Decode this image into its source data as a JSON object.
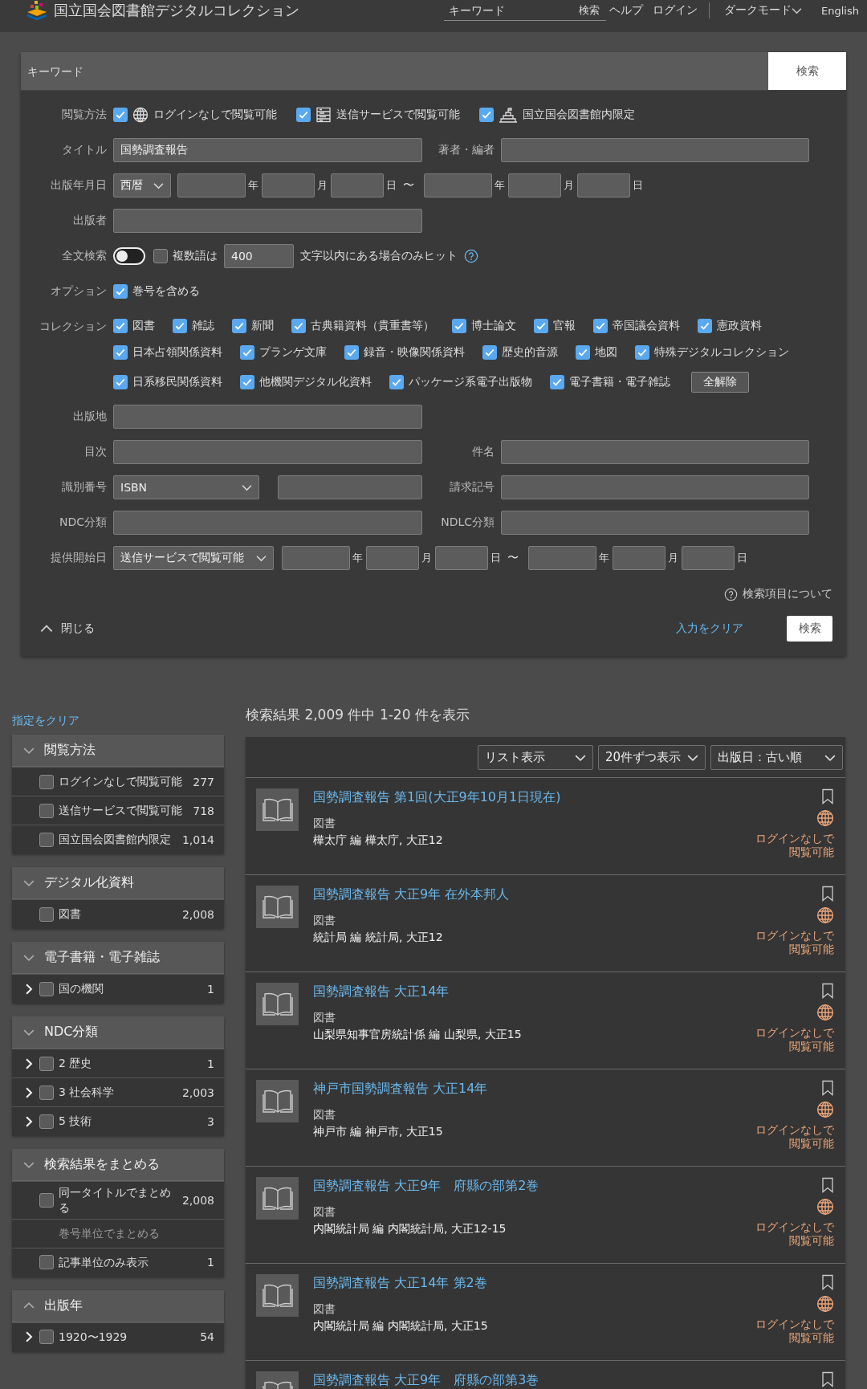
{
  "header": {
    "site_title": "国立国会図書館デジタルコレクション",
    "search_placeholder": "キーワード",
    "search_button": "検索",
    "links": [
      "ヘルプ",
      "ログイン"
    ],
    "dark_mode": "ダークモード",
    "language": "English"
  },
  "search_form": {
    "keyword_placeholder": "キーワード",
    "keyword_button": "検索",
    "access": {
      "label": "閲覧方法",
      "options": [
        {
          "label": "ログインなしで閲覧可能",
          "checked": true,
          "kind": "globe"
        },
        {
          "label": "送信サービスで閲覧可能",
          "checked": true,
          "kind": "transmission"
        },
        {
          "label": "国立国会図書館内限定",
          "checked": true,
          "kind": "building"
        }
      ]
    },
    "title": {
      "label": "タイトル",
      "value": "国勢調査報告"
    },
    "author": {
      "label": "著者・編者"
    },
    "publication_date": {
      "label": "出版年月日",
      "era": "西暦",
      "from_units": [
        "年",
        "月",
        "日"
      ],
      "separator": "〜",
      "to_units": [
        "年",
        "月",
        "日"
      ]
    },
    "publisher": {
      "label": "出版者"
    },
    "full_text": {
      "label": "全文検索",
      "toggle_on": false,
      "multi_word": {
        "label": "複数語は",
        "checked": false
      },
      "distance": "400",
      "suffix": "文字以内にある場合のみヒット"
    },
    "options": {
      "label": "オプション",
      "items": [
        {
          "label": "巻号を含める",
          "checked": true
        }
      ]
    },
    "collections": {
      "label": "コレクション",
      "clear_button": "全解除",
      "items": [
        {
          "label": "図書",
          "checked": true
        },
        {
          "label": "雑誌",
          "checked": true
        },
        {
          "label": "新聞",
          "checked": true
        },
        {
          "label": "古典籍資料（貴重書等）",
          "checked": true
        },
        {
          "label": "博士論文",
          "checked": true
        },
        {
          "label": "官報",
          "checked": true
        },
        {
          "label": "帝国議会資料",
          "checked": true
        },
        {
          "label": "憲政資料",
          "checked": true
        },
        {
          "label": "日本占領関係資料",
          "checked": true
        },
        {
          "label": "プランゲ文庫",
          "checked": true
        },
        {
          "label": "録音・映像関係資料",
          "checked": true
        },
        {
          "label": "歴史的音源",
          "checked": true
        },
        {
          "label": "地図",
          "checked": true
        },
        {
          "label": "特殊デジタルコレクション",
          "checked": true
        },
        {
          "label": "日系移民関係資料",
          "checked": true
        },
        {
          "label": "他機関デジタル化資料",
          "checked": true
        },
        {
          "label": "パッケージ系電子出版物",
          "checked": true
        },
        {
          "label": "電子書籍・電子雑誌",
          "checked": true
        }
      ]
    },
    "place": {
      "label": "出版地"
    },
    "contents": {
      "label": "目次"
    },
    "subject": {
      "label": "件名"
    },
    "identifier": {
      "label": "識別番号",
      "type": "ISBN"
    },
    "call_number": {
      "label": "請求記号"
    },
    "ndc": {
      "label": "NDC分類"
    },
    "ndlc": {
      "label": "NDLC分類"
    },
    "provision_date": {
      "label": "提供開始日",
      "type": "送信サービスで閲覧可能",
      "from_units": [
        "年",
        "月",
        "日"
      ],
      "separator": "〜",
      "to_units": [
        "年",
        "月",
        "日"
      ]
    },
    "help_link": "検索項目について",
    "close": "閉じる",
    "clear_link": "入力をクリア",
    "search_button": "検索"
  },
  "sidebar": {
    "clear_link": "指定をクリア",
    "facets": [
      {
        "title": "閲覧方法",
        "expanded": false,
        "items": [
          {
            "kind": "checkbox",
            "label": "ログインなしで閲覧可能",
            "count": "277",
            "checked": false,
            "has_children": false
          },
          {
            "kind": "checkbox",
            "label": "送信サービスで閲覧可能",
            "count": "718",
            "checked": false,
            "has_children": false
          },
          {
            "kind": "checkbox",
            "label": "国立国会図書館内限定",
            "count": "1,014",
            "checked": false,
            "has_children": false
          }
        ]
      },
      {
        "title": "デジタル化資料",
        "expanded": false,
        "items": [
          {
            "kind": "checkbox",
            "label": "図書",
            "count": "2,008",
            "checked": false,
            "has_children": false
          }
        ]
      },
      {
        "title": "電子書籍・電子雑誌",
        "expanded": false,
        "items": [
          {
            "kind": "checkbox",
            "label": "国の機関",
            "count": "1",
            "checked": false,
            "has_children": true
          }
        ]
      },
      {
        "title": "NDC分類",
        "expanded": false,
        "items": [
          {
            "kind": "checkbox",
            "label": "2 歴史",
            "count": "1",
            "checked": false,
            "has_children": true
          },
          {
            "kind": "checkbox",
            "label": "3 社会科学",
            "count": "2,003",
            "checked": false,
            "has_children": true
          },
          {
            "kind": "checkbox",
            "label": "5 技術",
            "count": "3",
            "checked": false,
            "has_children": true
          }
        ]
      },
      {
        "title": "検索結果をまとめる",
        "expanded": false,
        "items": [
          {
            "kind": "checkbox",
            "label": "同一タイトルでまとめる",
            "count": "2,008",
            "checked": false,
            "has_children": false
          },
          {
            "kind": "option",
            "label": "巻号単位でまとめる",
            "has_children": false
          },
          {
            "kind": "checkbox",
            "label": "記事単位のみ表示",
            "count": "1",
            "checked": false,
            "has_children": false
          }
        ]
      },
      {
        "title": "出版年",
        "expanded": true,
        "items": [
          {
            "kind": "checkbox",
            "label": "1920〜1929",
            "count": "54",
            "checked": false,
            "has_children": true
          }
        ]
      }
    ]
  },
  "results": {
    "summary": "検索結果 2,009 件中 1-20 件を表示",
    "selects": [
      "リスト表示",
      "20件ずつ表示",
      "出版日：古い順"
    ],
    "items": [
      {
        "title": "国勢調査報告 第1回(大正9年10月1日現在)",
        "type": "図書",
        "meta": "樺太庁 編 樺太庁, 大正12",
        "access": "ログインなしで閲覧可能"
      },
      {
        "title": "国勢調査報告 大正9年 在外本邦人",
        "type": "図書",
        "meta": "統計局 編 統計局, 大正12",
        "access": "ログインなしで閲覧可能"
      },
      {
        "title": "国勢調査報告 大正14年",
        "type": "図書",
        "meta": "山梨県知事官房統計係 編 山梨県, 大正15",
        "access": "ログインなしで閲覧可能"
      },
      {
        "title": "神戸市国勢調査報告 大正14年",
        "type": "図書",
        "meta": "神戸市 編 神戸市, 大正15",
        "access": "ログインなしで閲覧可能"
      },
      {
        "title": "国勢調査報告 大正9年　府縣の部第2巻",
        "type": "図書",
        "meta": "内閣統計局 編 内閣統計局, 大正12-15",
        "access": "ログインなしで閲覧可能"
      },
      {
        "title": "国勢調査報告 大正14年 第2巻",
        "type": "図書",
        "meta": "内閣統計局 編 内閣統計局, 大正15",
        "access": "ログインなしで閲覧可能"
      },
      {
        "title": "国勢調査報告 大正9年　府縣の部第3巻"
      }
    ]
  }
}
